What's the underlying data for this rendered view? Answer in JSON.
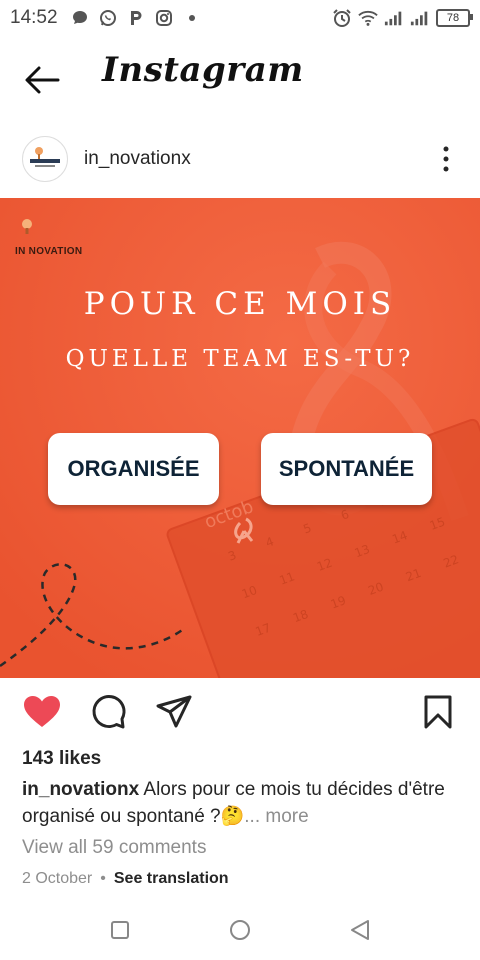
{
  "status_bar": {
    "time": "14:52",
    "battery": "78",
    "left_icons": [
      "chat-bubble-icon",
      "whatsapp-icon",
      "p-app-icon",
      "instagram-icon",
      "dot-icon"
    ],
    "right_icons": [
      "alarm-icon",
      "wifi-icon",
      "signal-icon",
      "signal-icon",
      "battery-icon"
    ]
  },
  "header": {
    "title": "Instagram",
    "back_icon": "arrow-left-icon"
  },
  "post": {
    "username": "in_novationx",
    "image": {
      "background_color": "#ee5a36",
      "brand_text": "IN NOVATION",
      "headline_line1": "POUR CE MOIS",
      "headline_line2": "QUELLE TEAM ES-TU?",
      "option_left": "ORGANISÉE",
      "option_right": "SPONTANÉE",
      "decor_word": "octob"
    },
    "actions": [
      "heart-icon",
      "comment-icon",
      "share-icon",
      "bookmark-icon"
    ],
    "likes": "143 likes",
    "caption_user": "in_novationx",
    "caption_text": " Alors pour ce mois tu décides d'être organisé ou spontané ?🤔",
    "caption_more": "... more",
    "comments_link": "View all 59 comments",
    "date": "2 October",
    "separator": "•",
    "see_translation": "See translation"
  },
  "colors": {
    "accent_heart": "#ed4956",
    "post_bg": "#ee5a36",
    "button_text": "#0e2336"
  }
}
